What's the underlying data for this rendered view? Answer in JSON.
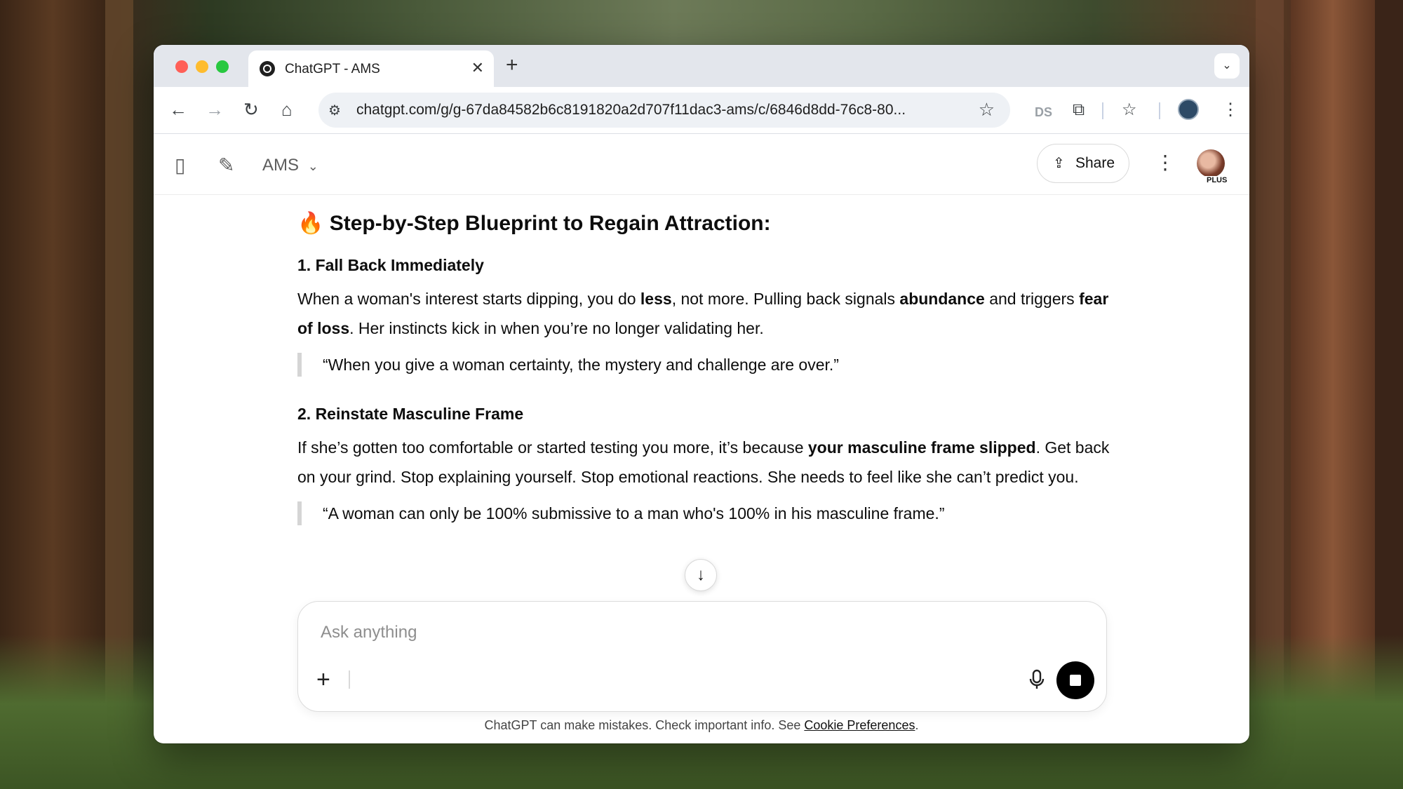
{
  "browser": {
    "tab_title": "ChatGPT - AMS",
    "tab_close": "✕",
    "new_tab": "+",
    "url": "chatgpt.com/g/g-67da84582b6c8191820a2d707f11dac3-ams/c/6846d8dd-76c8-80...",
    "back": "←",
    "forward": "→",
    "reload": "↻",
    "home": "⌂",
    "bookmark": "☆",
    "tab_list": "⌄",
    "extension_ds": "DS",
    "extension_puzzle": "⧉",
    "reading_list": "☆",
    "menu": "⋮",
    "traffic_lights": {
      "close": "#ff5f57",
      "minimize": "#febc2e",
      "maximize": "#28c840"
    }
  },
  "app": {
    "sidebar_toggle": "▯",
    "new_chat": "✎",
    "model_name": "AMS",
    "model_chevron": "⌄",
    "share_icon": "⇪",
    "share_label": "Share",
    "options": "⋮",
    "plan_badge": "PLUS"
  },
  "content": {
    "section_emoji": "🔥",
    "section_title": "Step-by-Step Blueprint to Regain Attraction:",
    "items": [
      {
        "heading": "1. Fall Back Immediately",
        "para": [
          {
            "t": "When a woman's interest starts dipping, you do "
          },
          {
            "t": "less",
            "b": true
          },
          {
            "t": ", not more. Pulling back signals "
          },
          {
            "t": "abundance",
            "b": true
          },
          {
            "t": " and triggers "
          },
          {
            "t": "fear of loss",
            "b": true
          },
          {
            "t": ". Her instincts kick in when you’re no longer validating her."
          }
        ],
        "quote": "“When you give a woman certainty, the mystery and challenge are over.”"
      },
      {
        "heading": "2. Reinstate Masculine Frame",
        "para": [
          {
            "t": "If she’s gotten too comfortable or started testing you more, it’s because "
          },
          {
            "t": "your masculine frame slipped",
            "b": true
          },
          {
            "t": ". Get back on your grind. Stop explaining yourself. Stop emotional reactions. She needs to feel like she can’t predict you."
          }
        ],
        "quote": "“A woman can only be 100% submissive to a man who's 100% in his masculine frame.”"
      }
    ]
  },
  "scroll_down": "↓",
  "composer": {
    "placeholder": "Ask anything",
    "plus": "+"
  },
  "footer": {
    "text": "ChatGPT can make mistakes. Check important info. See ",
    "link": "Cookie Preferences",
    "end": "."
  }
}
